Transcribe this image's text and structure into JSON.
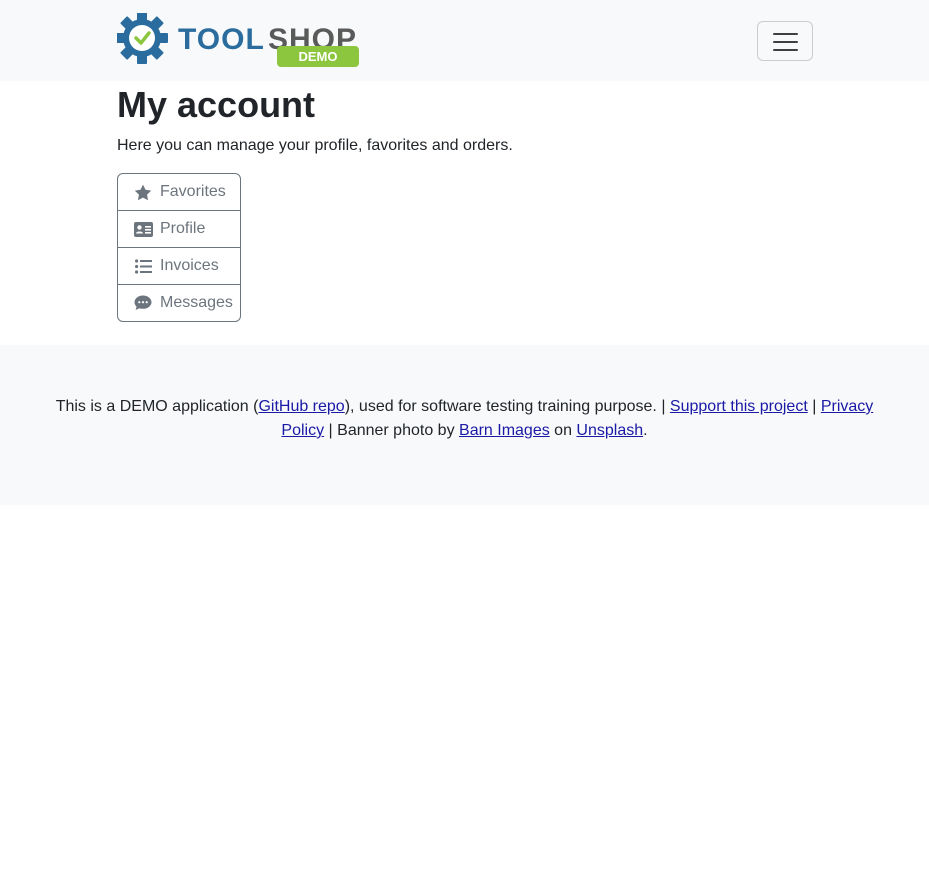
{
  "navbar": {
    "brand": {
      "text_main": "TOOLSHOP",
      "text_tool": "TOOL",
      "text_shop": "SHOP",
      "badge": "DEMO"
    },
    "toggler_icon": "hamburger-icon"
  },
  "page": {
    "title": "My account",
    "description": "Here you can manage your profile, favorites and orders."
  },
  "menu": {
    "items": [
      {
        "label": "Favorites",
        "icon": "star-icon"
      },
      {
        "label": "Profile",
        "icon": "id-card-icon"
      },
      {
        "label": "Invoices",
        "icon": "list-icon"
      },
      {
        "label": "Messages",
        "icon": "comment-icon"
      }
    ]
  },
  "footer": {
    "t1": "This is a DEMO application (",
    "github": "GitHub repo",
    "t2": "), used for software testing training purpose. | ",
    "support": "Support this project",
    "t3": " | ",
    "privacy": "Privacy Policy",
    "t4": " | Banner photo by ",
    "barn": "Barn Images",
    "t5": " on ",
    "unsplash": "Unsplash",
    "t6": "."
  },
  "colors": {
    "navbar_bg": "#f8f9fa",
    "logo_blue": "#2b6c9e",
    "logo_gray": "#5a5a5a",
    "badge_green": "#8cc63f",
    "menu_text": "#6c757d",
    "link": "#1a1aa6"
  }
}
